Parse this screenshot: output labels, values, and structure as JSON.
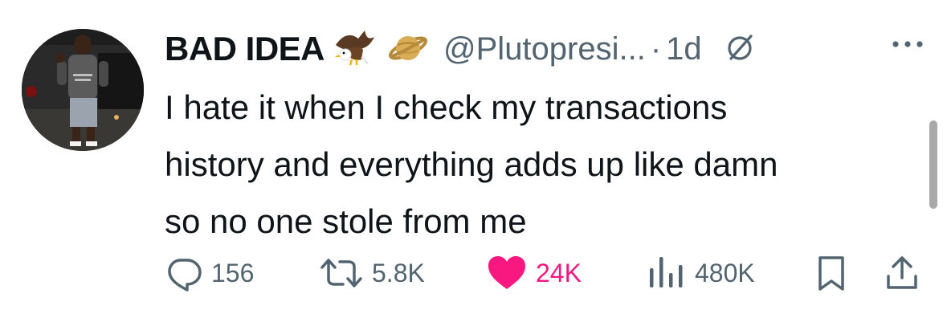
{
  "tweet": {
    "display_name": "BAD IDEA",
    "handle": "@Plutopresi...",
    "separator": "·",
    "time_ago": "1d",
    "text_lines": [
      "I hate it when I check my transactions",
      "history and everything adds up like damn",
      "so no one stole from me"
    ],
    "badges": [
      "eagle-emoji",
      "ringed-planet-emoji"
    ]
  },
  "actions": {
    "replies": "156",
    "reposts": "5.8K",
    "likes": "24K",
    "views": "480K"
  },
  "colors": {
    "text": "#0f1419",
    "secondary": "#536471",
    "like": "#f91880",
    "scrollbar": "#a9a9a9"
  },
  "icons": [
    "reply-icon",
    "repost-icon",
    "like-icon",
    "views-icon",
    "bookmark-icon",
    "share-icon",
    "grok-icon",
    "more-icon"
  ]
}
